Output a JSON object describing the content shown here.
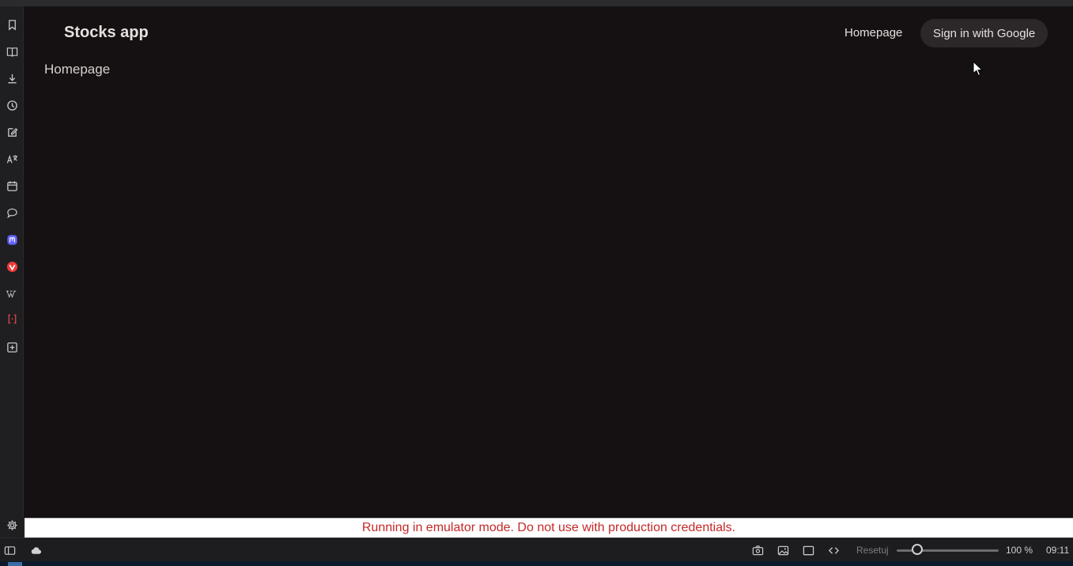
{
  "app": {
    "title": "Stocks app"
  },
  "nav": {
    "homepage_link": "Homepage",
    "signin_button": "Sign in with Google"
  },
  "main": {
    "heading": "Homepage"
  },
  "banner": {
    "text": "Running in emulator mode. Do not use with production credentials."
  },
  "sidebar": {
    "icons": [
      "bookmark-icon",
      "reading-list-icon",
      "download-icon",
      "history-icon",
      "notes-icon",
      "translate-icon",
      "calendar-icon",
      "chat-icon",
      "mastodon-icon",
      "vivaldi-icon",
      "wikipedia-icon",
      "brackets-icon",
      "add-panel-icon"
    ],
    "settings_icon": "gear-icon"
  },
  "statusbar": {
    "reset_label": "Resetuj",
    "zoom_level": "100 %",
    "zoom_fraction": 0.2,
    "clock": "09:11"
  },
  "colors": {
    "background": "#151112",
    "banner_text": "#c62828",
    "button_bg": "#2c2729"
  }
}
